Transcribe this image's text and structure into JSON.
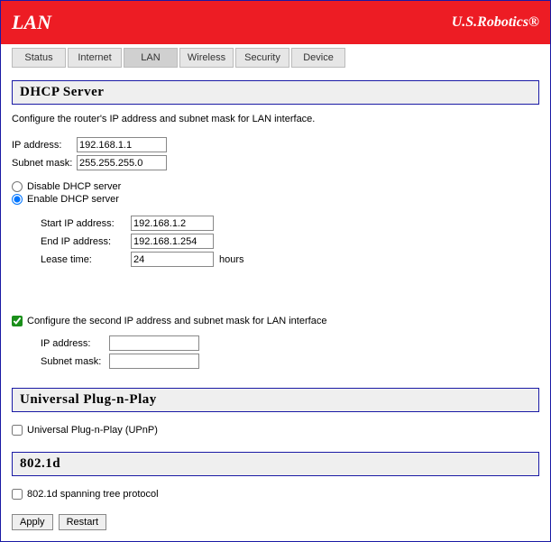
{
  "header": {
    "title": "LAN",
    "brand": "U.S.Robotics®"
  },
  "tabs": [
    "Status",
    "Internet",
    "LAN",
    "Wireless",
    "Security",
    "Device"
  ],
  "dhcp": {
    "title": "DHCP Server",
    "description": "Configure the router's IP address and subnet mask for LAN interface.",
    "ip_label": "IP address:",
    "ip_value": "192.168.1.1",
    "subnet_label": "Subnet mask:",
    "subnet_value": "255.255.255.0",
    "disable_label": "Disable DHCP server",
    "enable_label": "Enable DHCP server",
    "start_ip_label": "Start IP address:",
    "start_ip_value": "192.168.1.2",
    "end_ip_label": "End IP address:",
    "end_ip_value": "192.168.1.254",
    "lease_label": "Lease time:",
    "lease_value": "24",
    "lease_unit": "hours",
    "second_ip_label": "Configure the second IP address and subnet mask for LAN interface",
    "second_ip_addr_label": "IP address:",
    "second_subnet_label": "Subnet mask:"
  },
  "upnp": {
    "title": "Universal Plug-n-Play",
    "label": "Universal Plug-n-Play (UPnP)"
  },
  "stp": {
    "title": "802.1d",
    "label": "802.1d spanning tree protocol"
  },
  "buttons": {
    "apply": "Apply",
    "restart": "Restart"
  }
}
